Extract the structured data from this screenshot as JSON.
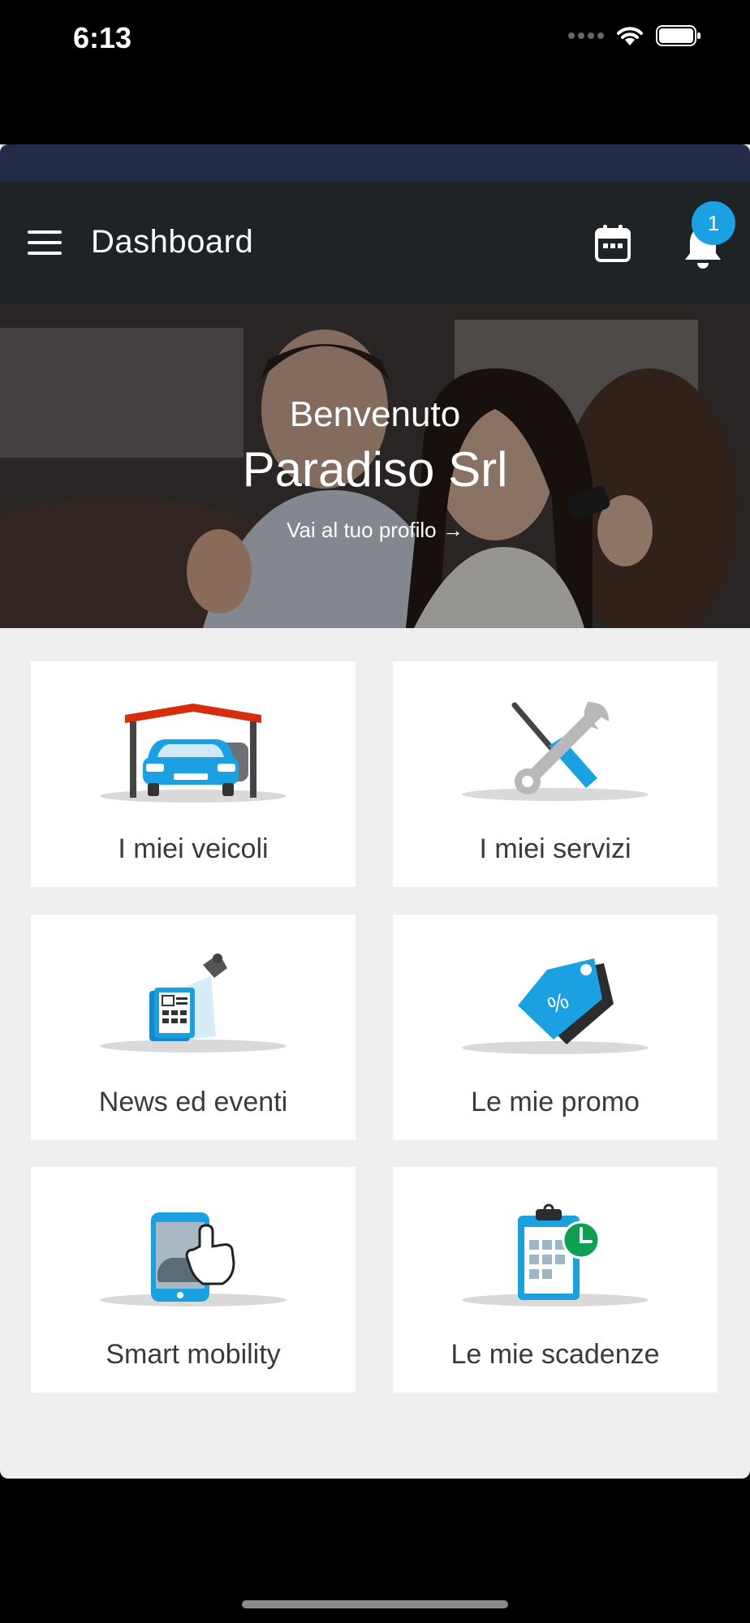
{
  "status_bar": {
    "time": "6:13"
  },
  "app_bar": {
    "title": "Dashboard",
    "notification_count": "1"
  },
  "hero": {
    "greeting": "Benvenuto",
    "name": "Paradiso Srl",
    "profile_link": "Vai al tuo profilo →"
  },
  "tiles": [
    {
      "label": "I miei veicoli",
      "icon": "garage-car-icon"
    },
    {
      "label": "I miei servizi",
      "icon": "tools-icon"
    },
    {
      "label": "News ed eventi",
      "icon": "newspaper-spotlight-icon"
    },
    {
      "label": "Le mie promo",
      "icon": "price-tag-icon"
    },
    {
      "label": "Smart mobility",
      "icon": "smartphone-tap-icon"
    },
    {
      "label": "Le mie scadenze",
      "icon": "calendar-clock-icon"
    }
  ],
  "colors": {
    "accent": "#1ba1e2",
    "app_bar": "#1f2326",
    "top_strip": "#232b48",
    "background": "#efefef"
  }
}
